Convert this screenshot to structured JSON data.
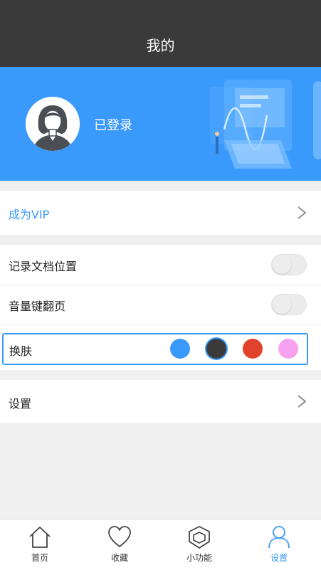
{
  "header": {
    "title": "我的"
  },
  "profile": {
    "status_text": "已登录"
  },
  "menu": {
    "vip_label": "成为VIP",
    "record_position_label": "记录文档位置",
    "record_position_on": false,
    "volume_flip_label": "音量键翻页",
    "volume_flip_on": false,
    "skin_label": "换肤",
    "skin_colors": [
      "#3a9afb",
      "#3a3a3a",
      "#e0432b",
      "#f7a2f0"
    ],
    "skin_selected_index": 1,
    "settings_label": "设置"
  },
  "tabbar": {
    "items": [
      {
        "label": "首页",
        "icon": "home-icon",
        "active": false
      },
      {
        "label": "收藏",
        "icon": "heart-icon",
        "active": false
      },
      {
        "label": "小功能",
        "icon": "shield-icon",
        "active": false
      },
      {
        "label": "设置",
        "icon": "user-icon",
        "active": true
      }
    ],
    "active_color": "#3a9afb"
  },
  "colors": {
    "accent": "#3a9afb",
    "header_bg": "#3a3a3a"
  }
}
